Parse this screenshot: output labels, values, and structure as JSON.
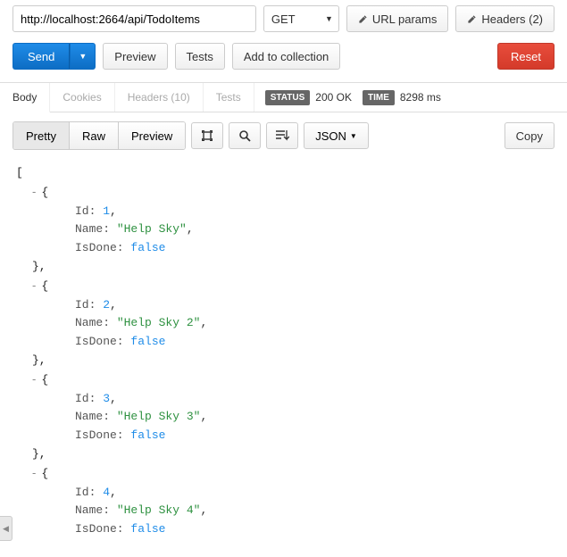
{
  "url": "http://localhost:2664/api/TodoItems",
  "method": "GET",
  "buttons": {
    "url_params": "URL params",
    "headers": "Headers (2)",
    "send": "Send",
    "preview": "Preview",
    "tests": "Tests",
    "add_collection": "Add to collection",
    "reset": "Reset",
    "copy": "Copy"
  },
  "response_tabs": {
    "body": "Body",
    "cookies": "Cookies",
    "headers": "Headers (10)",
    "tests": "Tests"
  },
  "status": {
    "label": "STATUS",
    "value": "200 OK",
    "time_label": "TIME",
    "time_value": "8298 ms"
  },
  "view": {
    "pretty": "Pretty",
    "raw": "Raw",
    "preview": "Preview",
    "format": "JSON"
  },
  "chart_data": {
    "type": "table",
    "title": "TodoItems API response",
    "columns": [
      "Id",
      "Name",
      "IsDone"
    ],
    "rows": [
      {
        "Id": 1,
        "Name": "Help Sky",
        "IsDone": false
      },
      {
        "Id": 2,
        "Name": "Help Sky 2",
        "IsDone": false
      },
      {
        "Id": 3,
        "Name": "Help Sky 3",
        "IsDone": false
      },
      {
        "Id": 4,
        "Name": "Help Sky 4",
        "IsDone": false
      }
    ]
  },
  "json_items": [
    {
      "Id": "1",
      "Name": "\"Help Sky\"",
      "IsDone": "false"
    },
    {
      "Id": "2",
      "Name": "\"Help Sky 2\"",
      "IsDone": "false"
    },
    {
      "Id": "3",
      "Name": "\"Help Sky 3\"",
      "IsDone": "false"
    },
    {
      "Id": "4",
      "Name": "\"Help Sky 4\"",
      "IsDone": "false"
    }
  ],
  "drawer_glyph": "◀"
}
